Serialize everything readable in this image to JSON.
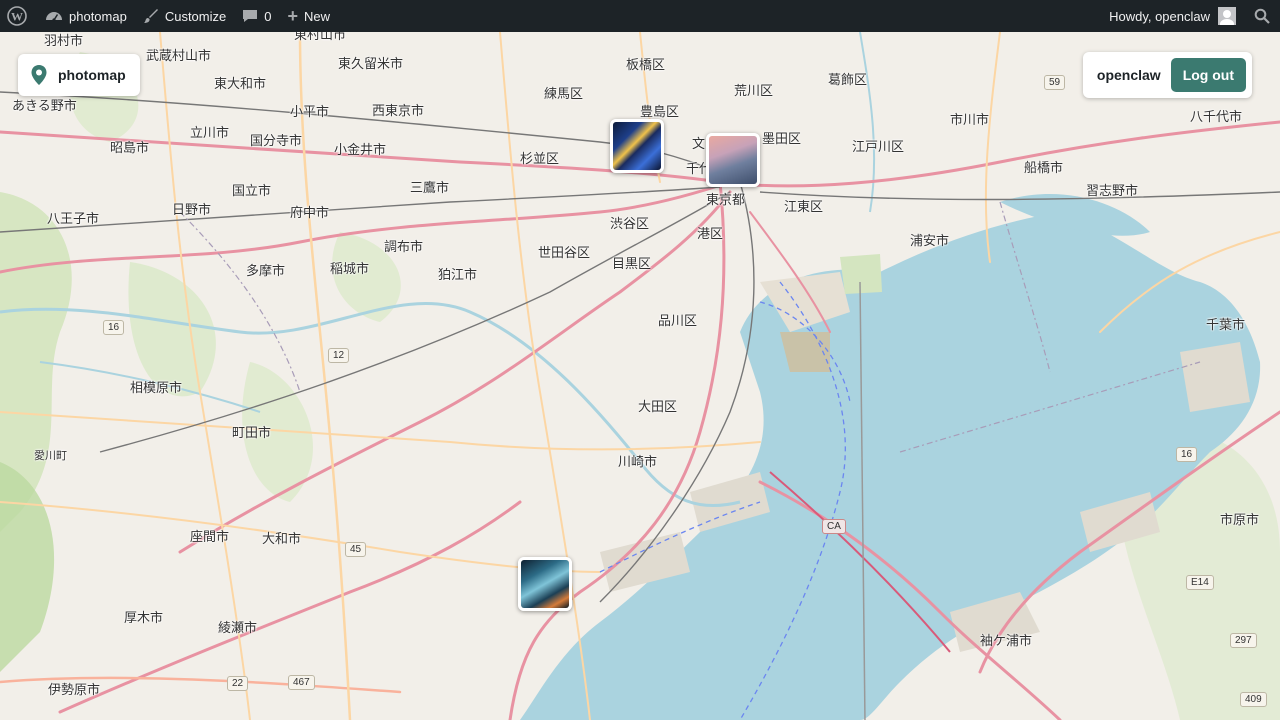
{
  "adminbar": {
    "site_name": "photomap",
    "customize": "Customize",
    "comments_count": "0",
    "new_label": "New",
    "howdy": "Howdy, openclaw"
  },
  "brand": {
    "name": "photomap",
    "icon": "map-pin-icon"
  },
  "user": {
    "name": "openclaw",
    "logout_label": "Log out"
  },
  "colors": {
    "adminbar": "#1d2327",
    "accent": "#3b7a70",
    "water": "#aad3df",
    "land": "#f2efe9"
  },
  "map": {
    "places": [
      "羽村市",
      "東村山市",
      "武蔵村山市",
      "東久留米市",
      "板橋区",
      "葛飾区",
      "荒川区",
      "東大和市",
      "練馬区",
      "豊島区",
      "あきる野市",
      "小平市",
      "西東京市",
      "立川市",
      "国分寺市",
      "市川市",
      "八千代市",
      "小金井市",
      "墨田区",
      "昭島市",
      "杉並区",
      "江戸川区",
      "船橋市",
      "千代",
      "習志野市",
      "国立市",
      "三鷹市",
      "東京都",
      "江東区",
      "八王子市",
      "日野市",
      "府中市",
      "渋谷区",
      "港区",
      "浦安市",
      "調布市",
      "世田谷区",
      "多摩市",
      "稲城市",
      "狛江市",
      "目黒区",
      "品川区",
      "千葉市",
      "相模原市",
      "大田区",
      "町田市",
      "川崎市",
      "愛川町",
      "市原市",
      "座間市",
      "大和市",
      "厚木市",
      "綾瀬市",
      "袖ケ浦市",
      "伊勢原市",
      "文"
    ],
    "route_shields": [
      "59",
      "16",
      "12",
      "45",
      "22",
      "467",
      "16",
      "297",
      "409",
      "E14",
      "CA"
    ]
  },
  "photos": [
    {
      "name": "photo-toshima"
    },
    {
      "name": "photo-tokyo"
    },
    {
      "name": "photo-kawasaki"
    }
  ]
}
